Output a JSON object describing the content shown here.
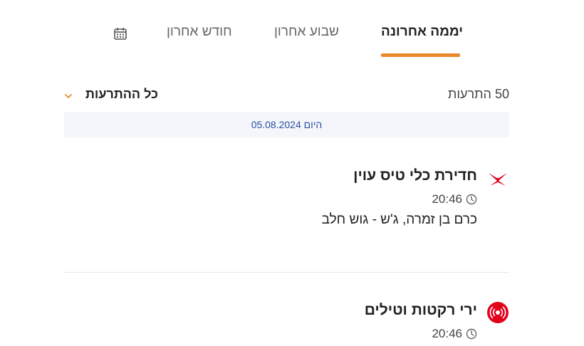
{
  "tabs": [
    {
      "label": "יממה אחרונה",
      "active": true
    },
    {
      "label": "שבוע אחרון",
      "active": false
    },
    {
      "label": "חודש אחרון",
      "active": false
    }
  ],
  "summary": {
    "count_text": "50 התרעות",
    "filter_label": "כל ההתרעות"
  },
  "date_header": "היום 05.08.2024",
  "alerts": [
    {
      "title": "חדירת כלי טיס עוין",
      "time": "20:46",
      "location": "כרם בן זמרה, ג'ש - גוש חלב",
      "icon": "aircraft-intrusion-icon"
    },
    {
      "title": "ירי רקטות וטילים",
      "time": "20:46",
      "icon": "rocket-alert-icon"
    }
  ],
  "colors": {
    "accent": "#e8892b",
    "alert_red": "#e3001b",
    "date_text": "#2a4ea0",
    "date_bg": "#f4f6fb"
  }
}
